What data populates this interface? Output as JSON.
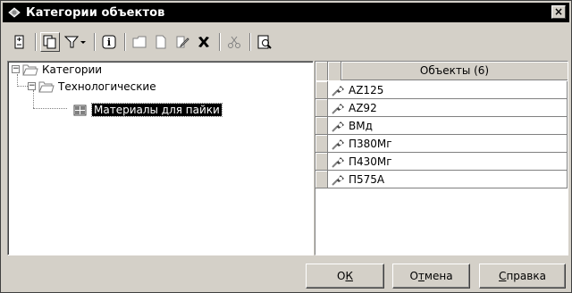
{
  "window": {
    "title": "Категории объектов",
    "close_label": "×"
  },
  "toolbar": {
    "buttons": [
      {
        "icon": "collapse-grid-icon"
      },
      {
        "icon": "copy-pages-icon",
        "active": true
      },
      {
        "icon": "filter-dropdown-icon"
      },
      {
        "icon": "info-icon"
      },
      {
        "icon": "folder-icon"
      },
      {
        "icon": "new-document-icon"
      },
      {
        "icon": "edit-icon"
      },
      {
        "icon": "delete-icon"
      },
      {
        "icon": "scissors-icon"
      },
      {
        "icon": "preview-icon"
      }
    ]
  },
  "tree": {
    "root": {
      "label": "Категории",
      "expander": "−"
    },
    "child": {
      "label": "Технологические",
      "expander": "−"
    },
    "leaf": {
      "label": "Материалы для пайки"
    }
  },
  "grid": {
    "header": "Объекты (6)",
    "rows": [
      "AZ125",
      "AZ92",
      "ВМд",
      "П380Мг",
      "П430Мг",
      "П575А"
    ]
  },
  "buttons": {
    "ok": {
      "prefix": "О",
      "underlined": "К",
      "suffix": ""
    },
    "cancel": {
      "prefix": "О",
      "underlined": "т",
      "suffix": "мена"
    },
    "help": {
      "prefix": "",
      "underlined": "С",
      "suffix": "правка"
    }
  }
}
